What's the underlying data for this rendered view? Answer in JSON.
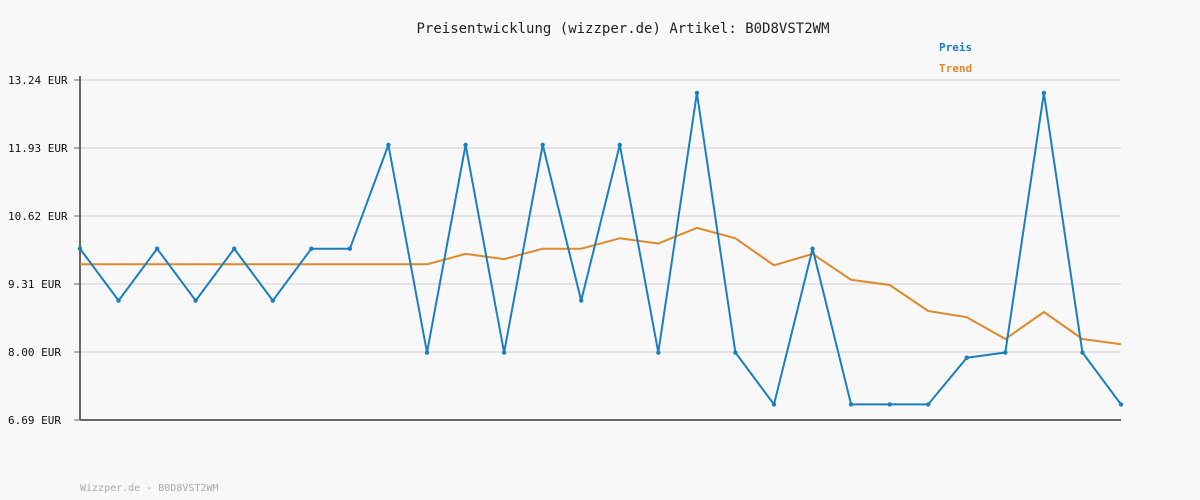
{
  "chart_data": {
    "type": "line",
    "title": "Preisentwicklung (wizzper.de) Artikel: B0D8VST2WM",
    "xlabel": "",
    "ylabel": "",
    "y_tick_labels": [
      "13.24 EUR",
      "11.93 EUR",
      "10.62 EUR",
      "9.31 EUR",
      "8.00 EUR",
      "6.69 EUR"
    ],
    "y_tick_values": [
      13.24,
      11.93,
      10.62,
      9.31,
      8.0,
      6.69
    ],
    "ylim": [
      6.69,
      13.24
    ],
    "grid": true,
    "legend_position": "top-right",
    "series": [
      {
        "name": "Preis",
        "color": "#1a7fc1",
        "values": [
          9.99,
          8.99,
          9.99,
          8.99,
          9.99,
          8.99,
          9.99,
          9.99,
          11.99,
          7.99,
          11.99,
          7.99,
          11.99,
          8.99,
          11.99,
          7.99,
          12.99,
          7.99,
          6.99,
          9.99,
          6.99,
          6.99,
          6.99,
          7.89,
          7.99,
          12.99,
          7.99,
          6.99
        ]
      },
      {
        "name": "Trend",
        "color": "#e0882a",
        "values": [
          9.69,
          9.69,
          9.69,
          9.69,
          9.69,
          9.69,
          9.69,
          9.69,
          9.69,
          9.69,
          9.89,
          9.79,
          9.99,
          9.99,
          10.19,
          10.09,
          10.39,
          10.19,
          9.67,
          9.89,
          9.39,
          9.29,
          8.79,
          8.67,
          8.25,
          8.77,
          8.25,
          8.15
        ]
      }
    ]
  },
  "footer": {
    "text": "Wizzper.de - B0D8VST2WM"
  }
}
